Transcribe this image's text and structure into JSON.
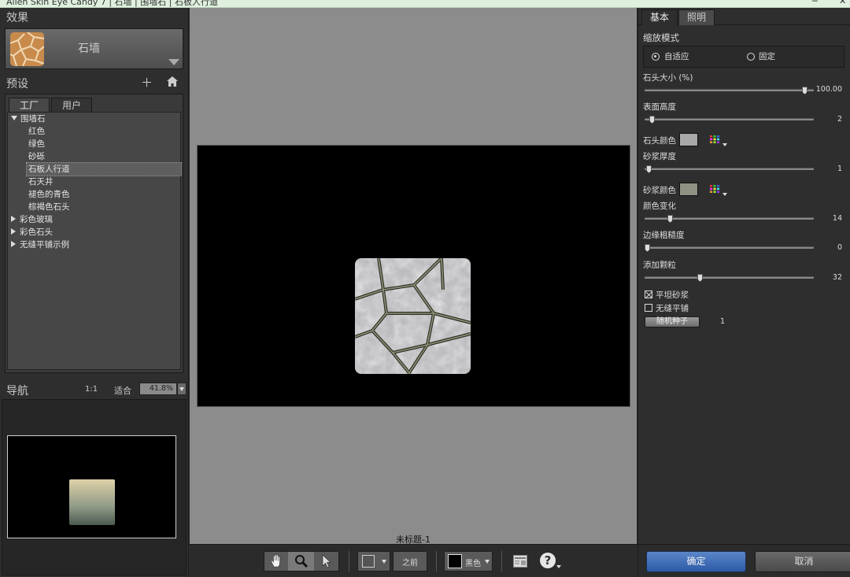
{
  "window": {
    "title": "Alien Skin Eye Candy 7 | 石墙 | 围墙石 | 石板人行道"
  },
  "effect": {
    "section_title": "效果",
    "name": "石墙"
  },
  "presets": {
    "section_title": "预设",
    "tabs": [
      "工厂",
      "用户"
    ],
    "tree": [
      {
        "label": "围墙石",
        "expanded": true,
        "level": 0
      },
      {
        "label": "红色",
        "level": 1
      },
      {
        "label": "绿色",
        "level": 1
      },
      {
        "label": "砂砾",
        "level": 1
      },
      {
        "label": "石板人行道",
        "level": 1,
        "selected": true
      },
      {
        "label": "石天井",
        "level": 1
      },
      {
        "label": "褪色的青色",
        "level": 1
      },
      {
        "label": "棕褐色石头",
        "level": 1
      },
      {
        "label": "彩色玻璃",
        "expanded": false,
        "level": 0
      },
      {
        "label": "彩色石头",
        "expanded": false,
        "level": 0
      },
      {
        "label": "无缝平铺示例",
        "expanded": false,
        "level": 0
      }
    ]
  },
  "navigator": {
    "section_title": "导航",
    "ratio": "1:1",
    "fit": "适合",
    "zoom": "41.8%"
  },
  "canvas": {
    "doc_title": "未标题-1"
  },
  "toolbar": {
    "before_label": "之前",
    "bg_label": "黑色",
    "help_icon": "?"
  },
  "settings": {
    "tabs": [
      "基本",
      "照明"
    ],
    "scale_mode_label": "缩放模式",
    "scale_options": [
      "自适应",
      "固定"
    ],
    "scale_selected": 0,
    "sliders": [
      {
        "label": "石头大小 (%)",
        "value": "100.00",
        "fraction": 0.96
      },
      {
        "label": "表面高度",
        "value": "2",
        "fraction": 0.03
      },
      {
        "label": "砂浆厚度",
        "value": "1",
        "fraction": 0.01
      },
      {
        "label": "颜色变化",
        "value": "14",
        "fraction": 0.14
      },
      {
        "label": "边缘粗糙度",
        "value": "0",
        "fraction": 0.0
      },
      {
        "label": "添加颗粒",
        "value": "32",
        "fraction": 0.32
      }
    ],
    "stone_color_label": "石头颜色",
    "stone_color": "#a8a8a8",
    "mortar_color_label": "砂浆颜色",
    "mortar_color": "#8f9183",
    "flat_mortar_label": "平坦砂浆",
    "flat_mortar_checked": true,
    "seamless_label": "无缝平铺",
    "seamless_checked": false,
    "random_seed_label": "随机种子",
    "random_seed_value": "1"
  },
  "actions": {
    "ok_label": "确定",
    "cancel_label": "取消"
  },
  "colors": {
    "ok_accent": "#3a6bb8",
    "canvas_bg": "#8c8c8c"
  }
}
